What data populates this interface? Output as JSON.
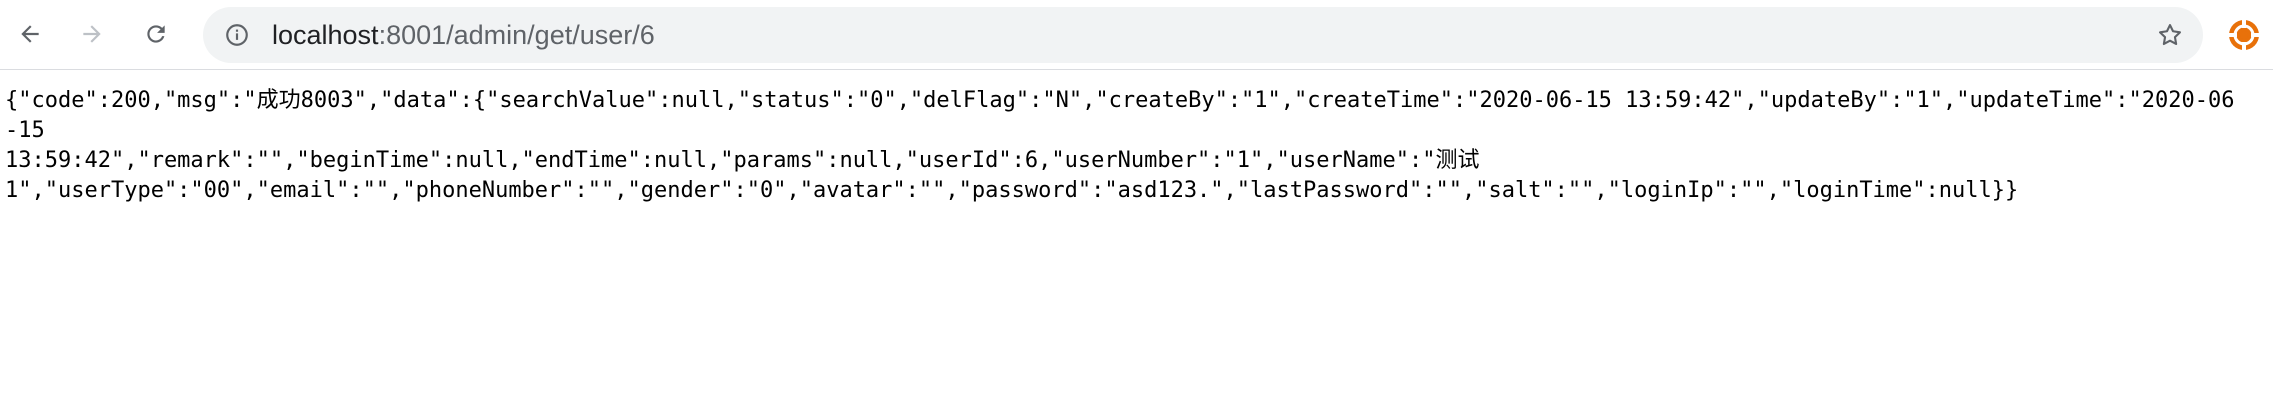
{
  "browser": {
    "back_icon": "arrow-left-icon",
    "forward_icon": "arrow-right-icon",
    "reload_icon": "reload-icon",
    "site_info_icon": "info-icon",
    "bookmark_icon": "star-icon",
    "extension_icon": "extension-icon",
    "url_host": "localhost",
    "url_path": ":8001/admin/get/user/6"
  },
  "page": {
    "json_line_1": "{\"code\":200,\"msg\":\"成功8003\",\"data\":{\"searchValue\":null,\"status\":\"0\",\"delFlag\":\"N\",\"createBy\":\"1\",\"createTime\":\"2020-06-15 13:59:42\",\"updateBy\":\"1\",\"updateTime\":\"2020-06-15",
    "json_line_2": "13:59:42\",\"remark\":\"\",\"beginTime\":null,\"endTime\":null,\"params\":null,\"userId\":6,\"userNumber\":\"1\",\"userName\":\"测试",
    "json_line_3": "1\",\"userType\":\"00\",\"email\":\"\",\"phoneNumber\":\"\",\"gender\":\"0\",\"avatar\":\"\",\"password\":\"asd123.\",\"lastPassword\":\"\",\"salt\":\"\",\"loginIp\":\"\",\"loginTime\":null}}"
  }
}
